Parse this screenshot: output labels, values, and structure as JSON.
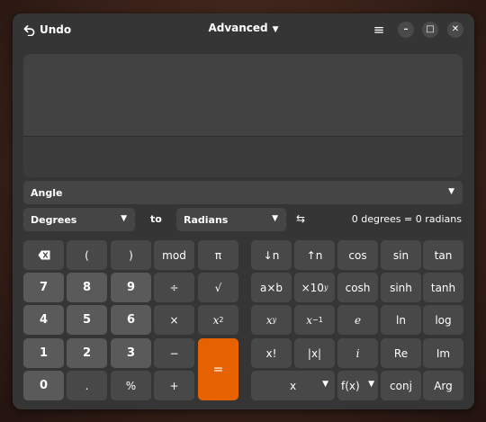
{
  "header": {
    "undo_label": "Undo",
    "mode_label": "Advanced",
    "icons": {
      "undo": "undo-icon",
      "mode_caret": "chevron-down-icon",
      "menu": "hamburger-menu-icon",
      "minimize": "minimize-icon",
      "maximize": "maximize-icon",
      "close": "close-icon"
    },
    "menu_glyph": "≡",
    "minimize_glyph": "–",
    "maximize_glyph": "□",
    "close_glyph": "✕"
  },
  "display": {
    "expression": "",
    "result": ""
  },
  "conversion": {
    "category": "Angle",
    "from_unit": "Degrees",
    "to_label": "to",
    "to_unit": "Radians",
    "swap_glyph": "⇆",
    "result_text": "0 degrees = 0 radians"
  },
  "keypad": {
    "backspace": "backspace-icon",
    "open_paren": "(",
    "close_paren": ")",
    "mod": "mod",
    "pi": "π",
    "d7": "7",
    "d8": "8",
    "d9": "9",
    "divide": "÷",
    "sqrt": "√",
    "d4": "4",
    "d5": "5",
    "d6": "6",
    "multiply": "×",
    "square_base": "x",
    "square_exp": "2",
    "d1": "1",
    "d2": "2",
    "d3": "3",
    "minus": "−",
    "equals": "=",
    "d0": "0",
    "decimal": ".",
    "percent": "%",
    "plus": "+"
  },
  "functions": {
    "shift_down": "↓n",
    "shift_up": "↑n",
    "cos": "cos",
    "sin": "sin",
    "tan": "tan",
    "axb": "a×b",
    "exp10_base": "×10",
    "exp10_exp": "y",
    "cosh": "cosh",
    "sinh": "sinh",
    "tanh": "tanh",
    "power_base": "x",
    "power_exp": "y",
    "inverse_base": "x",
    "inverse_exp": "−1",
    "e": "e",
    "ln": "ln",
    "log": "log",
    "factorial": "x!",
    "abs": "|x|",
    "i": "i",
    "re": "Re",
    "im": "Im",
    "variable": "x",
    "function": "f(x)",
    "conj": "conj",
    "arg": "Arg"
  }
}
